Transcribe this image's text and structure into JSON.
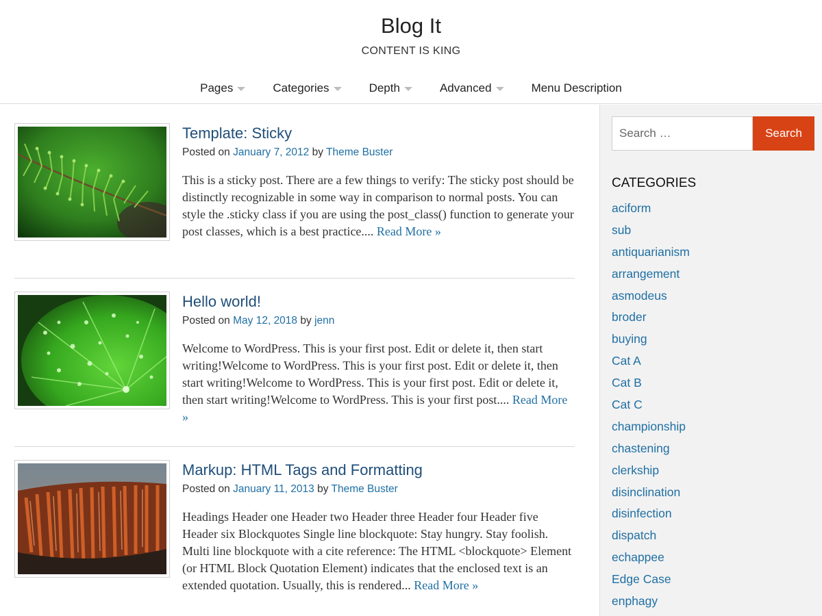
{
  "header": {
    "title": "Blog It",
    "tagline": "CONTENT IS KING"
  },
  "nav": {
    "items": [
      {
        "label": "Pages",
        "has_dropdown": true
      },
      {
        "label": "Categories",
        "has_dropdown": true
      },
      {
        "label": "Depth",
        "has_dropdown": true
      },
      {
        "label": "Advanced",
        "has_dropdown": true
      },
      {
        "label": "Menu Description",
        "has_dropdown": false
      }
    ]
  },
  "posts": [
    {
      "title": "Template: Sticky",
      "posted_on": "Posted on",
      "date": "January 7, 2012",
      "by": "by",
      "author": "Theme Buster",
      "excerpt": "This is a sticky post. There are a few things to verify: The sticky post should be distinctly recognizable in some way in comparison to normal posts. You can style the .sticky class if you are using the post_class() function to generate your post classes, which is a best practice....",
      "read_more": "Read More »"
    },
    {
      "title": "Hello world!",
      "posted_on": "Posted on",
      "date": "May 12, 2018",
      "by": "by",
      "author": "jenn",
      "excerpt": "Welcome to WordPress. This is your first post. Edit or delete it, then start writing!Welcome to WordPress. This is your first post. Edit or delete it, then start writing!Welcome to WordPress. This is your first post. Edit or delete it, then start writing!Welcome to WordPress. This is your first post....",
      "read_more": "Read More »"
    },
    {
      "title": "Markup: HTML Tags and Formatting",
      "posted_on": "Posted on",
      "date": "January 11, 2013",
      "by": "by",
      "author": "Theme Buster",
      "excerpt": "Headings Header one Header two Header three Header four Header five Header six Blockquotes Single line blockquote: Stay hungry. Stay foolish. Multi line blockquote with a cite reference: The HTML <blockquote> Element (or HTML Block Quotation Element) indicates that the enclosed text is an extended quotation. Usually, this is rendered...",
      "read_more": "Read More »"
    }
  ],
  "sidebar": {
    "search": {
      "placeholder": "Search …",
      "button_label": "Search"
    },
    "categories_title": "CATEGORIES",
    "categories": [
      "aciform",
      "sub",
      "antiquarianism",
      "arrangement",
      "asmodeus",
      "broder",
      "buying",
      "Cat A",
      "Cat B",
      "Cat C",
      "championship",
      "chastening",
      "clerkship",
      "disinclination",
      "disinfection",
      "dispatch",
      "echappee",
      "Edge Case",
      "enphagy"
    ]
  },
  "colors": {
    "title_link": "#1f4e79",
    "link": "#1f6fa3",
    "search_button": "#d84315",
    "sidebar_bg": "#f2f2f2"
  }
}
